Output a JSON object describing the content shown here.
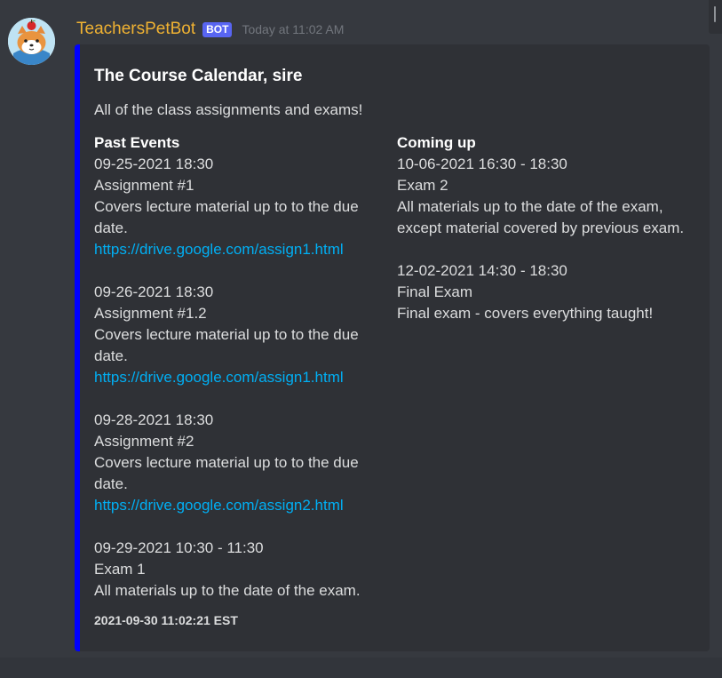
{
  "message": {
    "username": "TeachersPetBot",
    "bot_tag": "BOT",
    "timestamp": "Today at 11:02 AM",
    "avatar_icon": "shiba-dog-with-apple-avatar"
  },
  "embed": {
    "accent_color": "#0000ff",
    "title": "The Course Calendar, sire",
    "description": "All of the class assignments and exams!",
    "footer": "2021-09-30 11:02:21 EST",
    "fields": [
      {
        "name": "Past Events",
        "events": [
          {
            "when": "09-25-2021 18:30",
            "title": "Assignment #1",
            "desc": "Covers lecture material up to to the due date.",
            "link": "https://drive.google.com/assign1.html"
          },
          {
            "when": "09-26-2021 18:30",
            "title": "Assignment #1.2",
            "desc": "Covers lecture material up to to the due date.",
            "link": "https://drive.google.com/assign1.html"
          },
          {
            "when": "09-28-2021 18:30",
            "title": "Assignment #2",
            "desc": "Covers lecture material up to to the due date.",
            "link": "https://drive.google.com/assign2.html"
          },
          {
            "when": "09-29-2021 10:30 - 11:30",
            "title": "Exam 1",
            "desc": "All materials up to the date of the exam.",
            "link": ""
          }
        ]
      },
      {
        "name": "Coming up",
        "events": [
          {
            "when": "10-06-2021 16:30 - 18:30",
            "title": "Exam 2",
            "desc": "All materials up to the date of the exam, except material covered by previous exam.",
            "link": ""
          },
          {
            "when": "12-02-2021 14:30 - 18:30",
            "title": "Final Exam",
            "desc": "Final exam - covers everything taught!",
            "link": ""
          }
        ]
      }
    ]
  },
  "colors": {
    "background": "#36393f",
    "embed_background": "#2f3136",
    "username": "#f0b232",
    "bot_tag": "#5865f2",
    "link": "#00aff4"
  }
}
